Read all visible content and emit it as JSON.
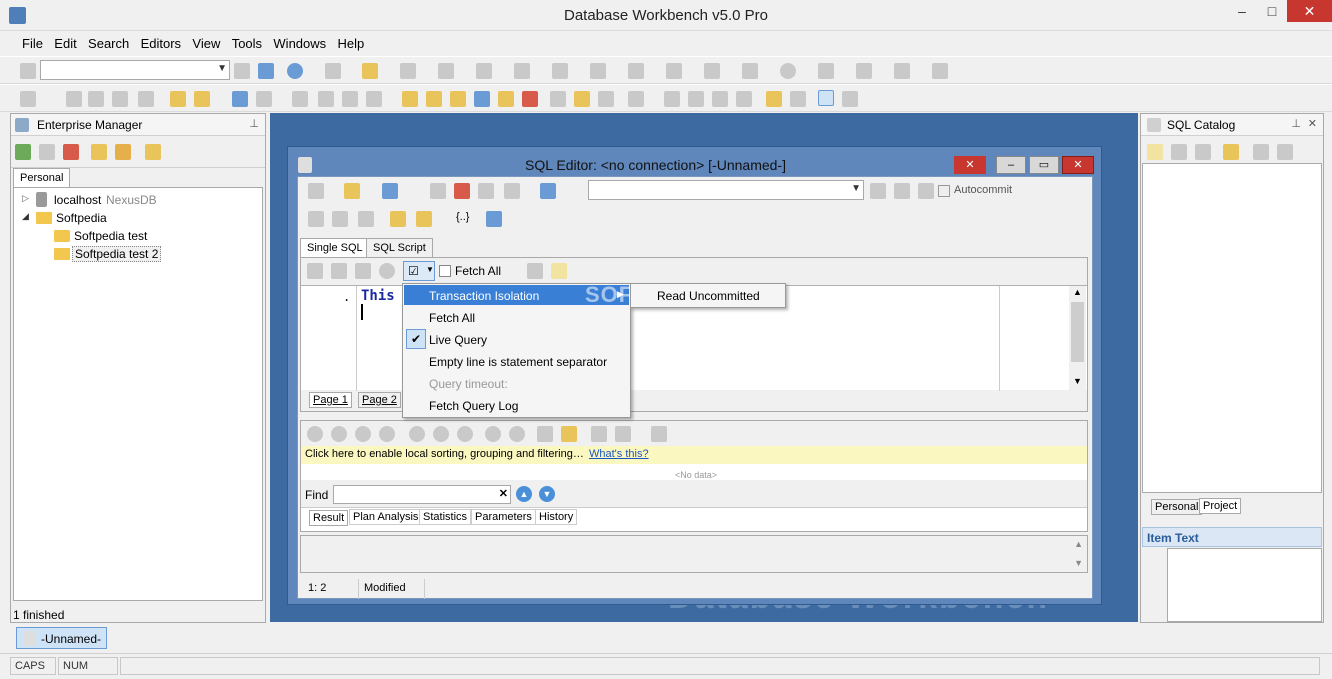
{
  "window": {
    "title": "Database Workbench v5.0 Pro",
    "minimize": "–",
    "maximize": "□",
    "close": "✕"
  },
  "menu": [
    "File",
    "Edit",
    "Search",
    "Editors",
    "View",
    "Tools",
    "Windows",
    "Help"
  ],
  "enterprise_manager": {
    "title": "Enterprise Manager",
    "tab": "Personal",
    "tree": [
      {
        "label": "localhost",
        "sub": "NexusDB"
      },
      {
        "label": "Softpedia"
      },
      {
        "label": "Softpedia test"
      },
      {
        "label": "Softpedia test 2"
      }
    ],
    "status": "1 finished"
  },
  "sql_catalog": {
    "title": "SQL Catalog",
    "tabs": [
      "Personal",
      "Project"
    ],
    "item_text_header": "Item Text"
  },
  "sql_editor": {
    "title": "SQL Editor: <no connection>  [-Unnamed-]",
    "autocommit": "Autocommit",
    "tabs": [
      "Single SQL",
      "SQL Script"
    ],
    "fetch_all": "Fetch All",
    "editor_text": "This",
    "page_tabs": [
      "Page 1",
      "Page 2"
    ],
    "filter_hint": "Click here to enable local sorting, grouping and filtering…",
    "whats_this": "What's this?",
    "no_data": "<No data>",
    "find_label": "Find",
    "result_tabs": [
      "Result",
      "Plan Analysis",
      "Statistics",
      "Parameters",
      "History"
    ],
    "status": {
      "pos": "1:  2",
      "modified": "Modified"
    }
  },
  "context_menu": {
    "items": [
      "Transaction Isolation",
      "Fetch All",
      "Live Query",
      "Empty line is statement separator",
      "Query timeout:",
      "Fetch Query Log"
    ],
    "submenu": "Read Uncommitted"
  },
  "watermark": "Database Workbench",
  "softpedia_mark": "SOFTPEDIA",
  "taskbar": {
    "item": "-Unnamed-"
  },
  "statusbar": [
    "CAPS",
    "NUM"
  ]
}
